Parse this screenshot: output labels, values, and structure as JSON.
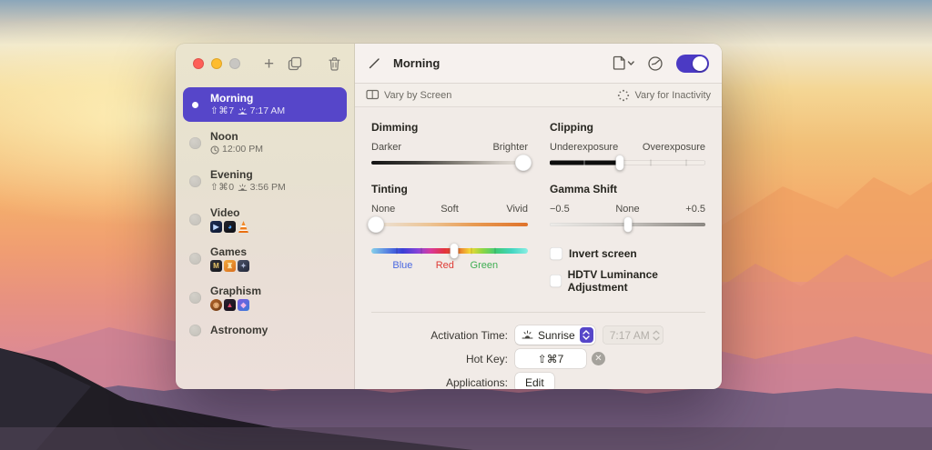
{
  "colors": {
    "accent_purple": "#5646c9",
    "selection_bg": "#5646c9",
    "sidebar_top": "#eae4ce",
    "sidebar_bottom": "#ecdfda",
    "main_bg": "#f1ebe7",
    "traffic_red": "#fe5f57",
    "traffic_yellow": "#febc2e",
    "traffic_gray": "#c8c6c2",
    "hue_label_blue": "#4a68e0",
    "hue_label_red": "#de3a34",
    "hue_label_green": "#3fae53"
  },
  "titlebar": {
    "add_label": "+",
    "icons": [
      "close-icon",
      "minimize-icon",
      "zoom-icon",
      "add-icon",
      "duplicate-icon",
      "trash-icon"
    ]
  },
  "sidebar": {
    "items": [
      {
        "name": "Morning",
        "selected": true,
        "hotkey": "⇧⌘7",
        "time_icon": "sunrise",
        "time": "7:17 AM"
      },
      {
        "name": "Noon",
        "selected": false,
        "time_icon": "clock",
        "time": "12:00 PM"
      },
      {
        "name": "Evening",
        "selected": false,
        "hotkey": "⇧⌘0",
        "time_icon": "sunrise",
        "time": "3:56 PM"
      },
      {
        "name": "Video",
        "selected": false,
        "apps": [
          {
            "icon": "video-player-app-icon",
            "shape": "square",
            "bg1": "#1c2c52",
            "bg2": "#101a33",
            "glyph": "▶",
            "fg": "#bcd6ff"
          },
          {
            "icon": "quicktime-app-icon",
            "shape": "square",
            "bg1": "#23242c",
            "bg2": "#0e0f15",
            "glyph": "◕",
            "fg": "#4da3ff"
          },
          {
            "icon": "vlc-cone-app-icon",
            "shape": "cone",
            "bg1": "#f08a2a",
            "bg2": "#e86f12",
            "glyph": "",
            "fg": "#fff"
          }
        ]
      },
      {
        "name": "Games",
        "selected": false,
        "apps": [
          {
            "icon": "game-m-app-icon",
            "shape": "square",
            "bg1": "#2e3038",
            "bg2": "#17181d",
            "glyph": "M",
            "fg": "#e8c66a"
          },
          {
            "icon": "game-orange-app-icon",
            "shape": "square",
            "bg1": "#f2a93b",
            "bg2": "#d96f1e",
            "glyph": "♜",
            "fg": "#fbe7b0"
          },
          {
            "icon": "game-emblem-app-icon",
            "shape": "square",
            "bg1": "#4a5268",
            "bg2": "#23283a",
            "glyph": "✦",
            "fg": "#aeb8d6"
          }
        ]
      },
      {
        "name": "Graphism",
        "selected": false,
        "apps": [
          {
            "icon": "acorn-app-icon",
            "shape": "circle",
            "bg1": "#b4652a",
            "bg2": "#6e3a14",
            "glyph": "◉",
            "fg": "#e8b07a"
          },
          {
            "icon": "affinity-app-icon",
            "shape": "square",
            "bg1": "#2a2030",
            "bg2": "#161019",
            "glyph": "▲",
            "fg": "#e0486e"
          },
          {
            "icon": "design-app-icon",
            "shape": "square",
            "bg1": "#7a5be0",
            "bg2": "#3a7ad8",
            "glyph": "◆",
            "fg": "#f0b5e8"
          }
        ]
      },
      {
        "name": "Astronomy",
        "selected": false
      }
    ]
  },
  "header": {
    "title": "Morning",
    "icons": [
      "pencil-icon",
      "document-icon",
      "chevron-down-icon",
      "gauge-icon"
    ],
    "toggle_on": true
  },
  "varybar": {
    "left_label": "Vary by Screen",
    "right_label": "Vary for Inactivity"
  },
  "controls": {
    "dimming": {
      "title": "Dimming",
      "left": "Darker",
      "right": "Brighter",
      "value_pct": 97
    },
    "clipping": {
      "title": "Clipping",
      "left": "Underexposure",
      "right": "Overexposure",
      "value_pct": 45,
      "ticks_pct": [
        22,
        65,
        88
      ]
    },
    "tinting": {
      "title": "Tinting",
      "left": "None",
      "mid": "Soft",
      "right": "Vivid",
      "value_pct": 3,
      "hue_pct": 53,
      "hue_ticks_pct": [
        16,
        32,
        64,
        79
      ],
      "hue_labels": [
        {
          "text": "Blue",
          "pct": 20
        },
        {
          "text": "Red",
          "pct": 47
        },
        {
          "text": "Green",
          "pct": 72
        }
      ]
    },
    "gamma": {
      "title": "Gamma Shift",
      "left": "−0.5",
      "mid": "None",
      "right": "+0.5",
      "value_pct": 50
    },
    "invert": {
      "label": "Invert screen",
      "checked": false
    },
    "hdtv": {
      "label": "HDTV Luminance Adjustment",
      "checked": false
    }
  },
  "footer": {
    "activation_label": "Activation Time:",
    "activation_value": "Sunrise",
    "activation_time": "7:17 AM",
    "hotkey_label": "Hot Key:",
    "hotkey_value": "⇧⌘7",
    "clear_glyph": "✕",
    "applications_label": "Applications:",
    "edit_label": "Edit"
  }
}
